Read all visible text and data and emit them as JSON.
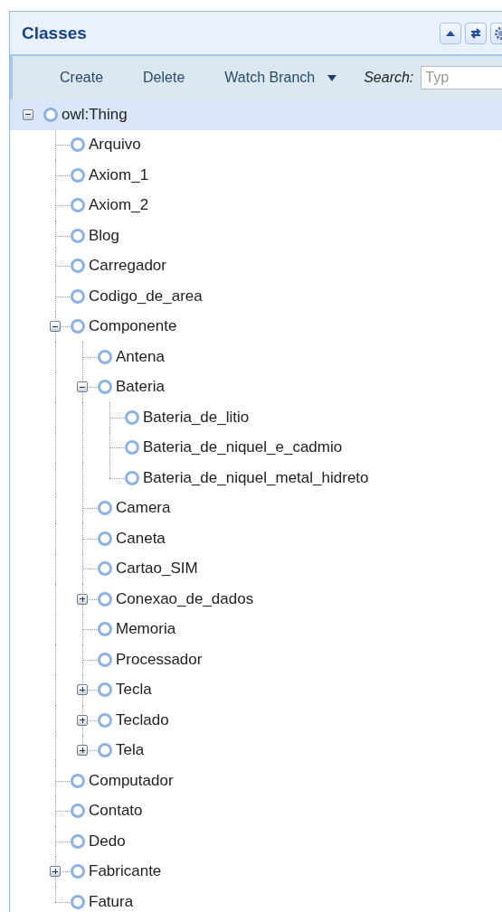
{
  "panel": {
    "title": "Classes",
    "header_buttons": [
      {
        "kind": "collapse"
      },
      {
        "kind": "refresh"
      },
      {
        "kind": "settings"
      }
    ]
  },
  "toolbar": {
    "buttons": [
      "Create",
      "Delete",
      "Watch Branch"
    ],
    "search_label": "Search:",
    "search_placeholder": "Typ"
  },
  "tree": {
    "label": "owl:Thing",
    "expanded": true,
    "selected": true,
    "children": [
      {
        "label": "Arquivo",
        "selected": false
      },
      {
        "label": "Axiom_1",
        "selected": false
      },
      {
        "label": "Axiom_2",
        "selected": false
      },
      {
        "label": "Blog",
        "selected": false
      },
      {
        "label": "Carregador",
        "selected": false
      },
      {
        "label": "Codigo_de_area",
        "selected": false
      },
      {
        "label": "Componente",
        "expanded": true,
        "selected": false,
        "children": [
          {
            "label": "Antena",
            "selected": false
          },
          {
            "label": "Bateria",
            "expanded": true,
            "selected": false,
            "children": [
              {
                "label": "Bateria_de_litio",
                "selected": false
              },
              {
                "label": "Bateria_de_niquel_e_cadmio",
                "selected": false
              },
              {
                "label": "Bateria_de_niquel_metal_hidreto",
                "selected": false
              }
            ]
          },
          {
            "label": "Camera",
            "selected": false
          },
          {
            "label": "Caneta",
            "selected": false
          },
          {
            "label": "Cartao_SIM",
            "selected": false
          },
          {
            "label": "Conexao_de_dados",
            "expanded": false,
            "selected": false
          },
          {
            "label": "Memoria",
            "selected": false
          },
          {
            "label": "Processador",
            "selected": false
          },
          {
            "label": "Tecla",
            "expanded": false,
            "selected": false
          },
          {
            "label": "Teclado",
            "expanded": false,
            "selected": false
          },
          {
            "label": "Tela",
            "expanded": false,
            "selected": false
          }
        ]
      },
      {
        "label": "Computador",
        "selected": false
      },
      {
        "label": "Contato",
        "selected": false
      },
      {
        "label": "Dedo",
        "selected": false
      },
      {
        "label": "Fabricante",
        "expanded": false,
        "selected": false
      },
      {
        "label": "Fatura",
        "selected": false
      }
    ]
  }
}
